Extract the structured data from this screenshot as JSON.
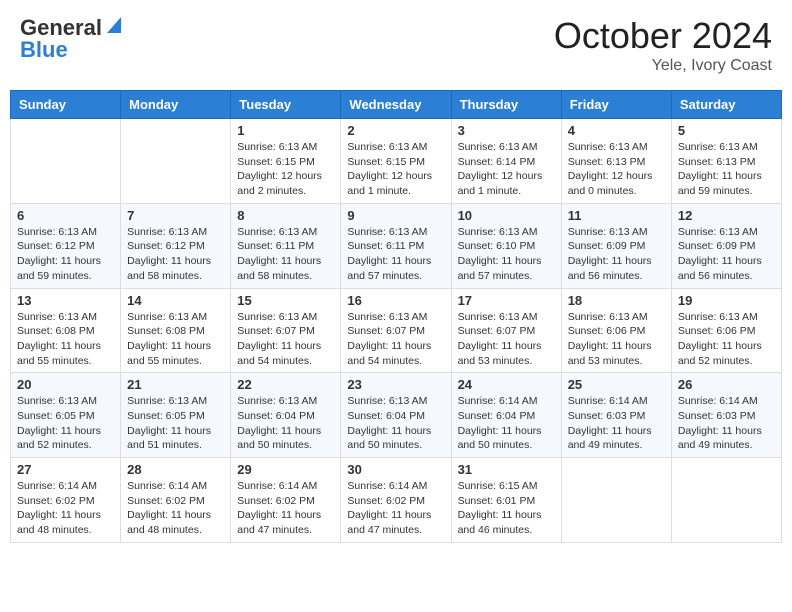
{
  "header": {
    "logo_line1": "General",
    "logo_line2": "Blue",
    "title": "October 2024",
    "subtitle": "Yele, Ivory Coast"
  },
  "weekdays": [
    "Sunday",
    "Monday",
    "Tuesday",
    "Wednesday",
    "Thursday",
    "Friday",
    "Saturday"
  ],
  "weeks": [
    [
      null,
      null,
      {
        "day": 1,
        "sunrise": "6:13 AM",
        "sunset": "6:15 PM",
        "daylight": "12 hours and 2 minutes."
      },
      {
        "day": 2,
        "sunrise": "6:13 AM",
        "sunset": "6:15 PM",
        "daylight": "12 hours and 1 minute."
      },
      {
        "day": 3,
        "sunrise": "6:13 AM",
        "sunset": "6:14 PM",
        "daylight": "12 hours and 1 minute."
      },
      {
        "day": 4,
        "sunrise": "6:13 AM",
        "sunset": "6:13 PM",
        "daylight": "12 hours and 0 minutes."
      },
      {
        "day": 5,
        "sunrise": "6:13 AM",
        "sunset": "6:13 PM",
        "daylight": "11 hours and 59 minutes."
      }
    ],
    [
      {
        "day": 6,
        "sunrise": "6:13 AM",
        "sunset": "6:12 PM",
        "daylight": "11 hours and 59 minutes."
      },
      {
        "day": 7,
        "sunrise": "6:13 AM",
        "sunset": "6:12 PM",
        "daylight": "11 hours and 58 minutes."
      },
      {
        "day": 8,
        "sunrise": "6:13 AM",
        "sunset": "6:11 PM",
        "daylight": "11 hours and 58 minutes."
      },
      {
        "day": 9,
        "sunrise": "6:13 AM",
        "sunset": "6:11 PM",
        "daylight": "11 hours and 57 minutes."
      },
      {
        "day": 10,
        "sunrise": "6:13 AM",
        "sunset": "6:10 PM",
        "daylight": "11 hours and 57 minutes."
      },
      {
        "day": 11,
        "sunrise": "6:13 AM",
        "sunset": "6:09 PM",
        "daylight": "11 hours and 56 minutes."
      },
      {
        "day": 12,
        "sunrise": "6:13 AM",
        "sunset": "6:09 PM",
        "daylight": "11 hours and 56 minutes."
      }
    ],
    [
      {
        "day": 13,
        "sunrise": "6:13 AM",
        "sunset": "6:08 PM",
        "daylight": "11 hours and 55 minutes."
      },
      {
        "day": 14,
        "sunrise": "6:13 AM",
        "sunset": "6:08 PM",
        "daylight": "11 hours and 55 minutes."
      },
      {
        "day": 15,
        "sunrise": "6:13 AM",
        "sunset": "6:07 PM",
        "daylight": "11 hours and 54 minutes."
      },
      {
        "day": 16,
        "sunrise": "6:13 AM",
        "sunset": "6:07 PM",
        "daylight": "11 hours and 54 minutes."
      },
      {
        "day": 17,
        "sunrise": "6:13 AM",
        "sunset": "6:07 PM",
        "daylight": "11 hours and 53 minutes."
      },
      {
        "day": 18,
        "sunrise": "6:13 AM",
        "sunset": "6:06 PM",
        "daylight": "11 hours and 53 minutes."
      },
      {
        "day": 19,
        "sunrise": "6:13 AM",
        "sunset": "6:06 PM",
        "daylight": "11 hours and 52 minutes."
      }
    ],
    [
      {
        "day": 20,
        "sunrise": "6:13 AM",
        "sunset": "6:05 PM",
        "daylight": "11 hours and 52 minutes."
      },
      {
        "day": 21,
        "sunrise": "6:13 AM",
        "sunset": "6:05 PM",
        "daylight": "11 hours and 51 minutes."
      },
      {
        "day": 22,
        "sunrise": "6:13 AM",
        "sunset": "6:04 PM",
        "daylight": "11 hours and 50 minutes."
      },
      {
        "day": 23,
        "sunrise": "6:13 AM",
        "sunset": "6:04 PM",
        "daylight": "11 hours and 50 minutes."
      },
      {
        "day": 24,
        "sunrise": "6:14 AM",
        "sunset": "6:04 PM",
        "daylight": "11 hours and 50 minutes."
      },
      {
        "day": 25,
        "sunrise": "6:14 AM",
        "sunset": "6:03 PM",
        "daylight": "11 hours and 49 minutes."
      },
      {
        "day": 26,
        "sunrise": "6:14 AM",
        "sunset": "6:03 PM",
        "daylight": "11 hours and 49 minutes."
      }
    ],
    [
      {
        "day": 27,
        "sunrise": "6:14 AM",
        "sunset": "6:02 PM",
        "daylight": "11 hours and 48 minutes."
      },
      {
        "day": 28,
        "sunrise": "6:14 AM",
        "sunset": "6:02 PM",
        "daylight": "11 hours and 48 minutes."
      },
      {
        "day": 29,
        "sunrise": "6:14 AM",
        "sunset": "6:02 PM",
        "daylight": "11 hours and 47 minutes."
      },
      {
        "day": 30,
        "sunrise": "6:14 AM",
        "sunset": "6:02 PM",
        "daylight": "11 hours and 47 minutes."
      },
      {
        "day": 31,
        "sunrise": "6:15 AM",
        "sunset": "6:01 PM",
        "daylight": "11 hours and 46 minutes."
      },
      null,
      null
    ]
  ],
  "labels": {
    "sunrise": "Sunrise:",
    "sunset": "Sunset:",
    "daylight": "Daylight:"
  }
}
